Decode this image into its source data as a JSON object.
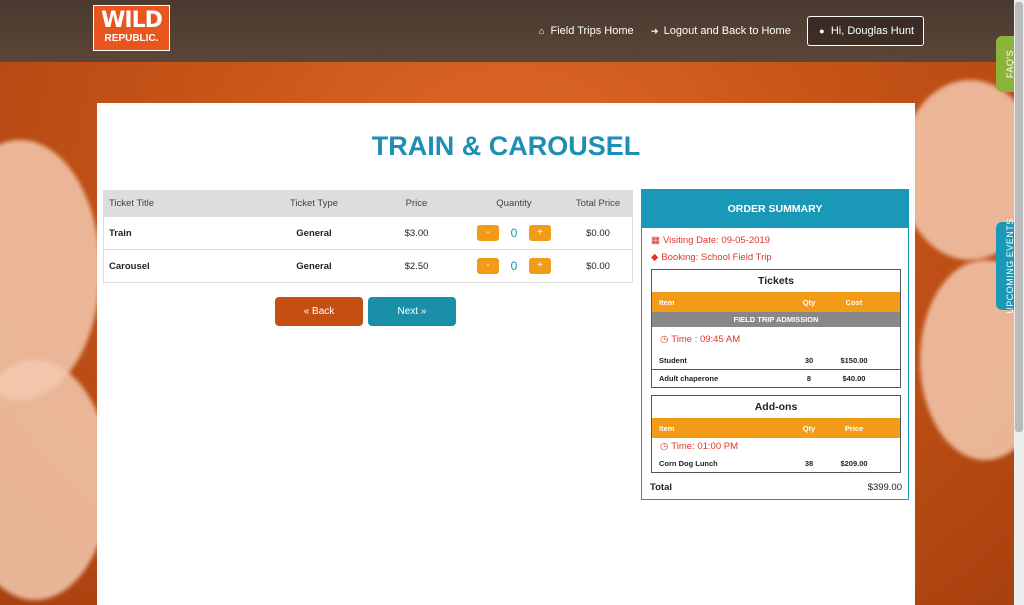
{
  "header": {
    "logo_line1": "WILD",
    "logo_line2": "REPUBLIC.",
    "nav_home": "Field Trips Home",
    "nav_logout": "Logout and Back to Home",
    "nav_user": "Hi, Douglas Hunt"
  },
  "sidetabs": {
    "faq": "FAQ'S",
    "upcoming": "UPCOMING EVENTS"
  },
  "page": {
    "title": "TRAIN & CAROUSEL"
  },
  "ticket_table": {
    "headers": [
      "Ticket Title",
      "Ticket Type",
      "Price",
      "Quantity",
      "Total Price"
    ],
    "rows": [
      {
        "title": "Train",
        "type": "General",
        "price": "$3.00",
        "qty": "0",
        "total": "$0.00"
      },
      {
        "title": "Carousel",
        "type": "General",
        "price": "$2.50",
        "qty": "0",
        "total": "$0.00"
      }
    ],
    "minus": "-",
    "plus": "+"
  },
  "actions": {
    "back": "« Back",
    "next": "Next »"
  },
  "summary": {
    "title": "ORDER SUMMARY",
    "visiting_date": "Visiting Date: 09-05-2019",
    "booking": "Booking: School Field Trip",
    "tickets": {
      "title": "Tickets",
      "col_item": "Item",
      "col_qty": "Qty",
      "col_cost": "Cost",
      "section": "FIELD TRIP ADMISSION",
      "time": "Time : 09:45 AM",
      "rows": [
        {
          "item": "Student",
          "qty": "30",
          "cost": "$150.00"
        },
        {
          "item": "Adult chaperone",
          "qty": "8",
          "cost": "$40.00"
        }
      ]
    },
    "addons": {
      "title": "Add-ons",
      "col_item": "Item",
      "col_qty": "Qty",
      "col_price": "Price",
      "time": "Time: 01:00 PM",
      "rows": [
        {
          "item": "Corn Dog Lunch",
          "qty": "38",
          "price": "$209.00"
        }
      ]
    },
    "total_label": "Total",
    "total_value": "$399.00"
  },
  "colors": {
    "accent": "#1d8fb5",
    "orange": "#f29b17",
    "back": "#c54e12",
    "alert": "#e0352a"
  }
}
